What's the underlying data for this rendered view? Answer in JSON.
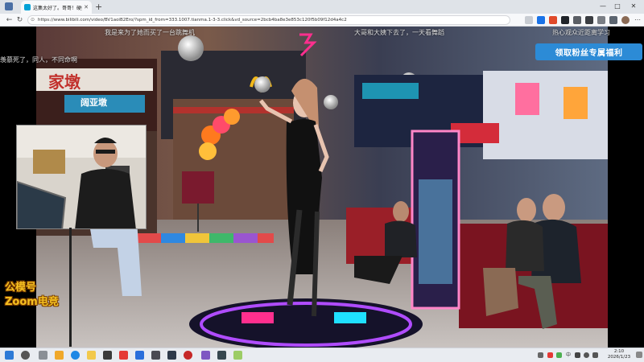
{
  "browser": {
    "tab_title": "这集太好了。哥哥！硬控你十",
    "new_tab": "+",
    "url": "https://www.bilibili.com/video/BV1aoiB2Ero/?spm_id_from=333.1007.tianma.1-3-3.click&vd_source=2bcb4ba8e3e853c120f5b09f12d4a4c2",
    "win_minimize": "—",
    "win_maximize": "□",
    "win_close": "✕",
    "back": "←",
    "refresh": "↻",
    "lock": "🔒",
    "menu": "⋯"
  },
  "video": {
    "danmaku": [
      "我是来为了她而买了一台跳舞机",
      "大哥和大姨下去了，一天看舞蹈",
      "热心观众近距离学习",
      "羡慕死了，同人，不同命啊"
    ],
    "fan_button": "领取粉丝专属福利",
    "watermark_line1": "公模号",
    "watermark_line2": "Zoom电竞",
    "signs": {
      "shop": "家墩",
      "shop_sub": "阔亚墩"
    }
  },
  "taskbar": {
    "clock_time": "2:10",
    "clock_date": "2026/1/23",
    "tray_lang": "中"
  },
  "colors": {
    "accent_blue": "#2c8bd6",
    "watermark_yellow": "#f5c020",
    "neon_pink": "#ff2f8e",
    "neon_cyan": "#1fe0ff"
  }
}
